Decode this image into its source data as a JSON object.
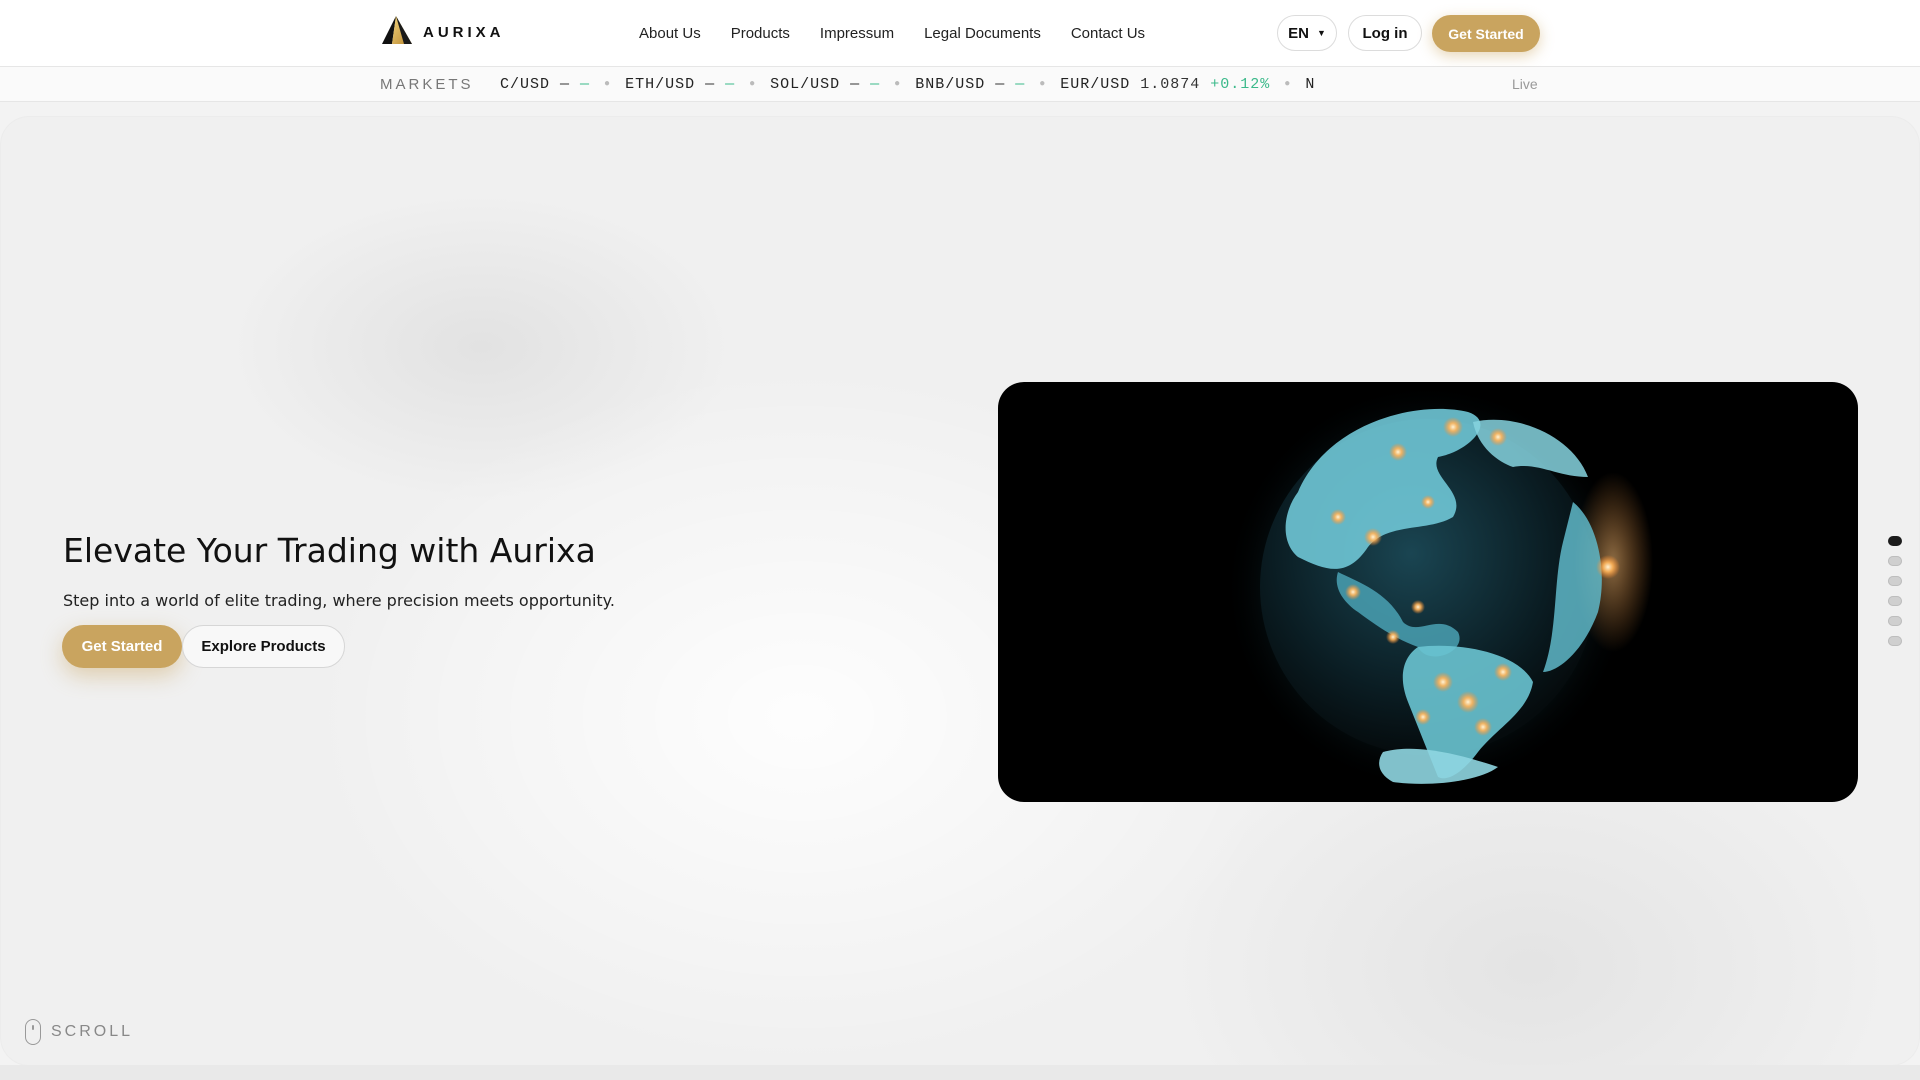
{
  "brand": {
    "name": "AURIXA",
    "accent_color": "#c9a45f",
    "logo_icon": "triangle-logo-icon"
  },
  "nav": {
    "items": [
      "About Us",
      "Products",
      "Impressum",
      "Legal Documents",
      "Contact Us"
    ]
  },
  "header_actions": {
    "language": "EN",
    "login_label": "Log in",
    "cta_label": "Get Started"
  },
  "ticker": {
    "label": "MARKETS",
    "items": [
      {
        "pair": "C/USD",
        "price": "—",
        "change": "—"
      },
      {
        "pair": "ETH/USD",
        "price": "—",
        "change": "—"
      },
      {
        "pair": "SOL/USD",
        "price": "—",
        "change": "—"
      },
      {
        "pair": "BNB/USD",
        "price": "—",
        "change": "—"
      },
      {
        "pair": "EUR/USD",
        "price": "1.0874",
        "change": "+0.12%"
      },
      {
        "pair": "N",
        "price": "",
        "change": ""
      }
    ],
    "status": "Live",
    "positive_color": "#3bb98a"
  },
  "hero": {
    "title": "Elevate Your Trading with Aurixa",
    "subtitle": "Step into a world of elite trading, where precision meets opportunity.",
    "primary_cta": "Get Started",
    "secondary_cta": "Explore Products",
    "media_icon": "globe-icon"
  },
  "section_nav": {
    "count": 6,
    "active_index": 0
  },
  "scroll_hint": {
    "label": "SCROLL",
    "icon": "mouse-icon"
  }
}
